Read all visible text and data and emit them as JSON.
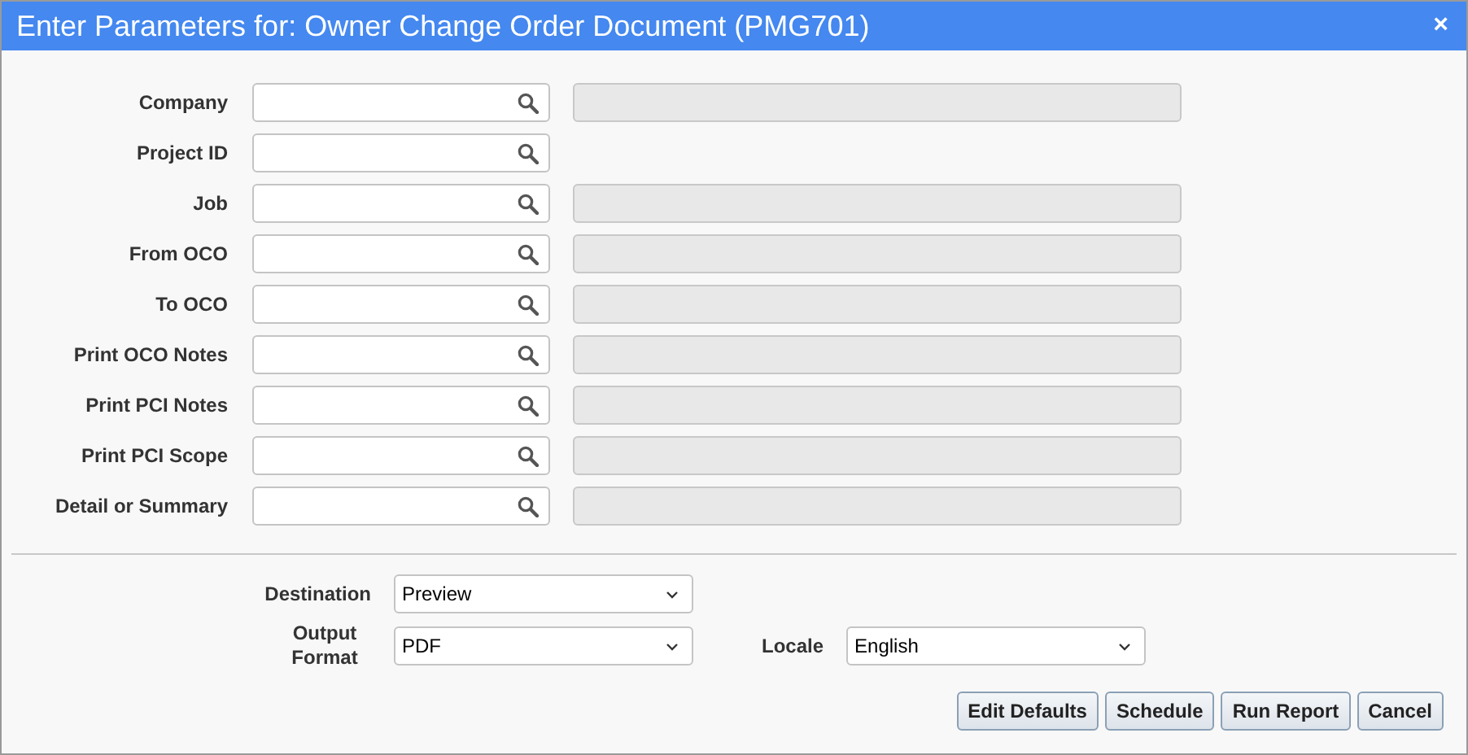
{
  "window": {
    "title": "Enter Parameters for: Owner Change Order Document (PMG701)",
    "close": "×"
  },
  "parameters": [
    {
      "label": "Company",
      "description_field": true
    },
    {
      "label": "Project ID",
      "description_field": false
    },
    {
      "label": "Job",
      "description_field": true
    },
    {
      "label": "From OCO",
      "description_field": true
    },
    {
      "label": "To OCO",
      "description_field": true
    },
    {
      "label": "Print OCO Notes",
      "description_field": true
    },
    {
      "label": "Print PCI Notes",
      "description_field": true
    },
    {
      "label": "Print PCI Scope",
      "description_field": true
    },
    {
      "label": "Detail or Summary",
      "description_field": true
    }
  ],
  "destination": {
    "label": "Destination",
    "value": "Preview"
  },
  "output_format": {
    "label": "Output Format",
    "value": "PDF"
  },
  "locale": {
    "label": "Locale",
    "value": "English"
  },
  "buttons": [
    "Edit Defaults",
    "Schedule",
    "Run Report",
    "Cancel"
  ]
}
